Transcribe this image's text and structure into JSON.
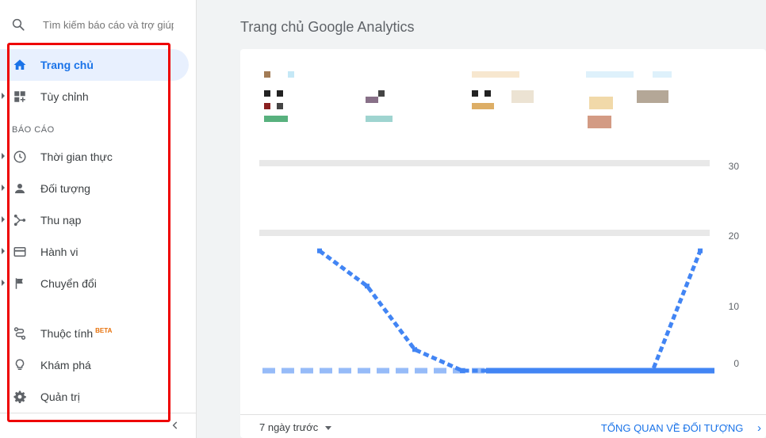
{
  "search": {
    "placeholder": "Tìm kiếm báo cáo và trợ giúp"
  },
  "nav": {
    "home": "Trang chủ",
    "customize": "Tùy chỉnh",
    "reports_header": "BÁO CÁO",
    "realtime": "Thời gian thực",
    "audience": "Đối tượng",
    "acquisition": "Thu nạp",
    "behavior": "Hành vi",
    "conversions": "Chuyển đổi",
    "attribution": "Thuộc tính",
    "attribution_badge": "BETA",
    "discover": "Khám phá",
    "admin": "Quản trị"
  },
  "main": {
    "title": "Trang chủ Google Analytics",
    "date_range": "7 ngày trước",
    "audience_overview": "TỔNG QUAN VỀ ĐỐI TƯỢNG"
  },
  "chart_data": {
    "type": "line",
    "yticks": [
      "30",
      "20",
      "10",
      "0"
    ],
    "ylim": [
      0,
      30
    ],
    "grid": true,
    "series": [
      {
        "values": [
          17,
          12,
          3,
          0,
          0,
          0,
          0,
          0,
          17
        ]
      }
    ]
  },
  "colors": {
    "accent": "#1a73e8",
    "highlight": "#ee0000",
    "active_bg": "#e8f0fe",
    "line": "#4285f4"
  }
}
